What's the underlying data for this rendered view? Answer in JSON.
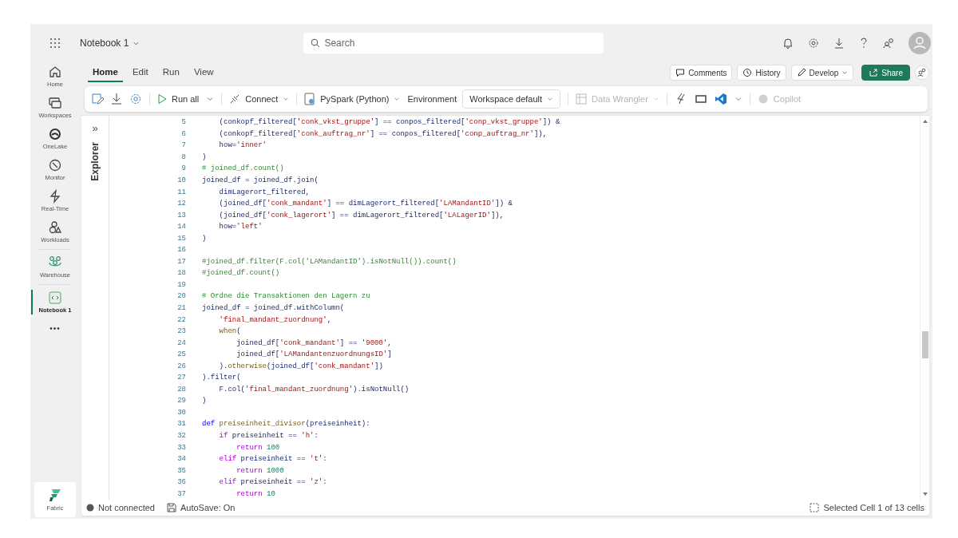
{
  "topbar": {
    "app_title": "Notebook 1",
    "search": {
      "placeholder": "Search"
    }
  },
  "sidebar": {
    "items": [
      {
        "label": "Home",
        "selected": false
      },
      {
        "label": "Workspaces",
        "selected": false
      },
      {
        "label": "OneLake",
        "selected": false
      },
      {
        "label": "Monitor",
        "selected": false
      },
      {
        "label": "Real-Time",
        "selected": false
      },
      {
        "label": "Workloads",
        "selected": false
      },
      {
        "label": "Warehouse",
        "selected": false
      },
      {
        "label": "Notebook 1",
        "selected": true
      }
    ],
    "more": "•••",
    "footer": "Fabric"
  },
  "tabs": [
    {
      "label": "Home",
      "selected": true
    },
    {
      "label": "Edit",
      "selected": false
    },
    {
      "label": "Run",
      "selected": false
    },
    {
      "label": "View",
      "selected": false
    }
  ],
  "header_buttons": [
    {
      "label": "Comments",
      "kind": "comments"
    },
    {
      "label": "History",
      "kind": "history"
    },
    {
      "label": "Develop",
      "kind": "develop"
    },
    {
      "label": "Share",
      "kind": "share"
    }
  ],
  "toolbar": {
    "run_all": "Run all",
    "connect": "Connect",
    "language": "PySpark (Python)",
    "environment_label": "Environment",
    "environment": "Workspace default",
    "data_wrangler": {
      "label": "Data Wrangler",
      "disabled": true
    },
    "copilot": {
      "label": "Copilot",
      "disabled": true
    }
  },
  "explorer": {
    "label": "Explorer",
    "toggle": "»"
  },
  "code": [
    {
      "num": "5",
      "tokens": [
        {
          "t": "    (conkopf_filtered[",
          "kind": "plain"
        },
        {
          "t": "'conk_vkst_gruppe'",
          "kind": "string"
        },
        {
          "t": "] == conpos_filtered[",
          "kind": "plain"
        },
        {
          "t": "'conp_vkst_gruppe'",
          "kind": "string"
        },
        {
          "t": "]) &",
          "kind": "plain"
        }
      ]
    },
    {
      "num": "6",
      "tokens": [
        {
          "t": "    (conkopf_filtered[",
          "kind": "plain"
        },
        {
          "t": "'conk_auftrag_nr'",
          "kind": "string"
        },
        {
          "t": "] == conpos_filtered[",
          "kind": "plain"
        },
        {
          "t": "'conp_auftrag_nr'",
          "kind": "string"
        },
        {
          "t": "]),",
          "kind": "plain"
        }
      ]
    },
    {
      "num": "7",
      "tokens": [
        {
          "t": "    how=",
          "kind": "plain"
        },
        {
          "t": "'inner'",
          "kind": "string"
        }
      ]
    },
    {
      "num": "8",
      "tokens": [
        {
          "t": ")",
          "kind": "plain"
        }
      ]
    },
    {
      "num": "9",
      "tokens": [
        {
          "t": "# joined_df.count()",
          "kind": "comment"
        }
      ]
    },
    {
      "num": "10",
      "tokens": [
        {
          "t": "joined_df = joined_df.join(",
          "kind": "plain"
        }
      ]
    },
    {
      "num": "11",
      "tokens": [
        {
          "t": "    dimLagerort_filtered,",
          "kind": "plain"
        }
      ]
    },
    {
      "num": "12",
      "tokens": [
        {
          "t": "    (joined_df[",
          "kind": "plain"
        },
        {
          "t": "'conk_mandant'",
          "kind": "string"
        },
        {
          "t": "] == dimLagerort_filtered[",
          "kind": "plain"
        },
        {
          "t": "'LAMandantID'",
          "kind": "string"
        },
        {
          "t": "]) &",
          "kind": "plain"
        }
      ]
    },
    {
      "num": "13",
      "tokens": [
        {
          "t": "    (joined_df[",
          "kind": "plain"
        },
        {
          "t": "'conk_lagerort'",
          "kind": "string"
        },
        {
          "t": "] == dimLagerort_filtered[",
          "kind": "plain"
        },
        {
          "t": "'LALagerID'",
          "kind": "string"
        },
        {
          "t": "]),",
          "kind": "plain"
        }
      ]
    },
    {
      "num": "14",
      "tokens": [
        {
          "t": "    how=",
          "kind": "plain"
        },
        {
          "t": "'left'",
          "kind": "string"
        }
      ]
    },
    {
      "num": "15",
      "tokens": [
        {
          "t": ")",
          "kind": "plain"
        }
      ]
    },
    {
      "num": "16"
    },
    {
      "num": "17",
      "tokens": [
        {
          "t": "#joined_df.filter(F.col('LAMandantID').isNotNull()).count()",
          "kind": "comment"
        }
      ]
    },
    {
      "num": "18",
      "tokens": [
        {
          "t": "#joined_df.count()",
          "kind": "comment"
        }
      ]
    },
    {
      "num": "19"
    },
    {
      "num": "20",
      "tokens": [
        {
          "t": "# Ordne die Transaktionen den Lagern zu",
          "kind": "comment"
        }
      ]
    },
    {
      "num": "21",
      "tokens": [
        {
          "t": "joined_df = joined_df.withColumn(",
          "kind": "plain"
        }
      ]
    },
    {
      "num": "22",
      "tokens": [
        {
          "t": "    'final_mandant_zuordnung'",
          "kind": "string"
        },
        {
          "t": ",",
          "kind": "plain"
        }
      ]
    },
    {
      "num": "23",
      "tokens": [
        {
          "t": "    when",
          "kind": "function"
        },
        {
          "t": "(",
          "kind": "plain"
        }
      ]
    },
    {
      "num": "24",
      "tokens": [
        {
          "t": "        joined_df[",
          "kind": "plain"
        },
        {
          "t": "'conk_mandant'",
          "kind": "string"
        },
        {
          "t": "] == ",
          "kind": "plain"
        },
        {
          "t": "'9000'",
          "kind": "string"
        },
        {
          "t": ",",
          "kind": "plain"
        }
      ]
    },
    {
      "num": "25",
      "tokens": [
        {
          "t": "        joined_df[",
          "kind": "plain"
        },
        {
          "t": "'LAMandantenzuordnungsID'",
          "kind": "string"
        },
        {
          "t": "]",
          "kind": "plain"
        }
      ]
    },
    {
      "num": "26",
      "tokens": [
        {
          "t": "    ).",
          "kind": "plain"
        },
        {
          "t": "otherwise",
          "kind": "function"
        },
        {
          "t": "(joined_df[",
          "kind": "plain"
        },
        {
          "t": "'conk_mandant'",
          "kind": "string"
        },
        {
          "t": "])",
          "kind": "plain"
        }
      ]
    },
    {
      "num": "27",
      "tokens": [
        {
          "t": ").filter(",
          "kind": "plain"
        }
      ]
    },
    {
      "num": "28",
      "tokens": [
        {
          "t": "    F.col(",
          "kind": "plain"
        },
        {
          "t": "'final_mandant_zuordnung'",
          "kind": "string"
        },
        {
          "t": ").isNotNull()",
          "kind": "plain"
        }
      ]
    },
    {
      "num": "29",
      "tokens": [
        {
          "t": ")",
          "kind": "plain"
        }
      ]
    },
    {
      "num": "30"
    },
    {
      "num": "31",
      "tokens": [
        {
          "t": "def",
          "kind": "definition"
        },
        {
          "t": " preiseinheit_divisor",
          "kind": "function"
        },
        {
          "t": "(preiseinheit):",
          "kind": "plain"
        }
      ]
    },
    {
      "num": "32",
      "tokens": [
        {
          "t": "    if",
          "kind": "keyword"
        },
        {
          "t": " preiseinheit == ",
          "kind": "plain"
        },
        {
          "t": "'h'",
          "kind": "string"
        },
        {
          "t": ":",
          "kind": "plain"
        }
      ]
    },
    {
      "num": "33",
      "tokens": [
        {
          "t": "        return",
          "kind": "keyword"
        },
        {
          "t": " 100",
          "kind": "number"
        }
      ]
    },
    {
      "num": "34",
      "tokens": [
        {
          "t": "    elif",
          "kind": "keyword"
        },
        {
          "t": " preiseinheit == ",
          "kind": "plain"
        },
        {
          "t": "'t'",
          "kind": "string"
        },
        {
          "t": ":",
          "kind": "plain"
        }
      ]
    },
    {
      "num": "35",
      "tokens": [
        {
          "t": "        return",
          "kind": "keyword"
        },
        {
          "t": " 1000",
          "kind": "number"
        }
      ]
    },
    {
      "num": "36",
      "tokens": [
        {
          "t": "    elif",
          "kind": "keyword"
        },
        {
          "t": " preiseinheit == ",
          "kind": "plain"
        },
        {
          "t": "'z'",
          "kind": "string"
        },
        {
          "t": ":",
          "kind": "plain"
        }
      ]
    },
    {
      "num": "37",
      "tokens": [
        {
          "t": "        return",
          "kind": "keyword"
        },
        {
          "t": " 10",
          "kind": "number"
        }
      ]
    }
  ],
  "status_bar": {
    "connection": "Not connected",
    "connected": false,
    "autosave": "AutoSave: On",
    "selection": "Selected Cell 1 of 13 cells"
  }
}
